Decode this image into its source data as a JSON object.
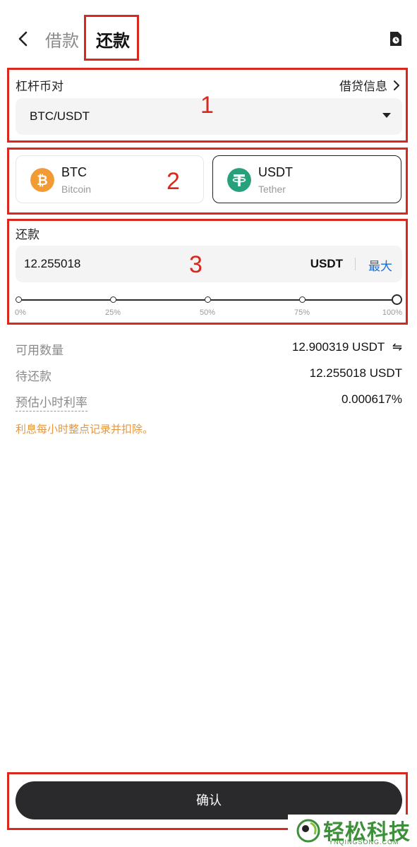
{
  "header": {
    "tab_borrow": "借款",
    "tab_repay": "还款",
    "back_icon": "chevron-left-icon",
    "history_icon": "clock-document-icon"
  },
  "pair": {
    "label": "杠杆币对",
    "loan_info": "借贷信息",
    "selected": "BTC/USDT"
  },
  "coins": [
    {
      "symbol": "BTC",
      "name": "Bitcoin",
      "color": "#f29a33",
      "glyph": "₿",
      "selected": false
    },
    {
      "symbol": "USDT",
      "name": "Tether",
      "color": "#26a17b",
      "glyph": "T",
      "selected": true
    }
  ],
  "repay": {
    "label": "还款",
    "amount": "12.255018",
    "unit": "USDT",
    "max_label": "最大",
    "percent": 100,
    "ticks": [
      "0%",
      "25%",
      "50%",
      "75%",
      "100%"
    ]
  },
  "info": {
    "available_label": "可用数量",
    "available_value": "12.900319 USDT",
    "pending_label": "待还款",
    "pending_value": "12.255018 USDT",
    "rate_label": "预估小时利率",
    "rate_value": "0.000617%",
    "notice": "利息每小时整点记录并扣除。"
  },
  "confirm_label": "确认",
  "annotations": [
    "1",
    "2",
    "3"
  ],
  "watermark": {
    "text": "轻松科技",
    "sub": "YNQINGSONG.COM"
  },
  "colors": {
    "accent_blue": "#1c6ed6",
    "notice_orange": "#e8963c",
    "annotation_red": "#d9281e",
    "button_dark": "#2a2a2c"
  }
}
